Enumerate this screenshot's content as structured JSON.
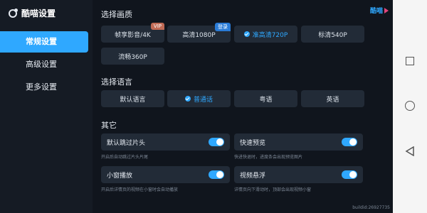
{
  "sidebar": {
    "brand_title": "酷喵设置",
    "items": [
      {
        "label": "常规设置",
        "active": true
      },
      {
        "label": "高级设置",
        "active": false
      },
      {
        "label": "更多设置",
        "active": false
      }
    ]
  },
  "main": {
    "brand_mark": "酷喵",
    "quality": {
      "title": "选择画质",
      "options": [
        {
          "label": "帧享影音/4K",
          "badge": "VIP",
          "selected": false
        },
        {
          "label": "高清1080P",
          "badge": "登录",
          "selected": false
        },
        {
          "label": "准高清720P",
          "badge": "",
          "selected": true
        },
        {
          "label": "标清540P",
          "badge": "",
          "selected": false
        },
        {
          "label": "流畅360P",
          "badge": "",
          "selected": false
        }
      ]
    },
    "language": {
      "title": "选择语言",
      "options": [
        {
          "label": "默认语言",
          "selected": false
        },
        {
          "label": "普通话",
          "selected": true
        },
        {
          "label": "粤语",
          "selected": false
        },
        {
          "label": "英语",
          "selected": false
        }
      ]
    },
    "other": {
      "title": "其它",
      "toggles": [
        {
          "label": "默认跳过片头",
          "on": true,
          "hint": "开启后自动跳过片头片尾"
        },
        {
          "label": "快速预览",
          "on": true,
          "hint": "快进快退时，进度条会出现预览图片"
        },
        {
          "label": "小窗播放",
          "on": true,
          "hint": "开启后详情页的视频在小窗时会自动播放"
        },
        {
          "label": "视频悬浮",
          "on": true,
          "hint": "详情页向下滑动时，顶部会出现视频小窗"
        }
      ]
    },
    "build_id": "buildid:26927735"
  },
  "colors": {
    "accent": "#2fa8ff",
    "background": "#10151d",
    "chip": "#222b37",
    "vip_badge": "#c06a55",
    "login_badge": "#2a7bd6"
  },
  "system_nav": {
    "icons": [
      "recent-apps-icon",
      "home-icon",
      "back-icon"
    ]
  }
}
